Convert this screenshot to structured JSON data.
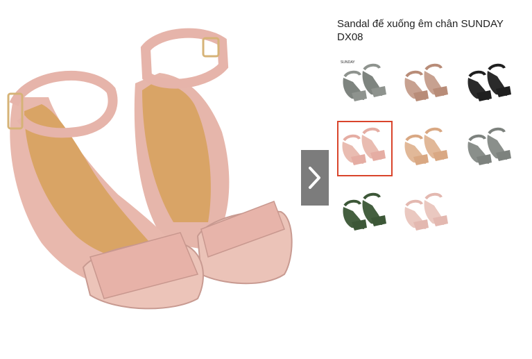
{
  "product": {
    "title": "Sandal đế xuống êm chân SUNDAY DX08",
    "main_color": "#e9bcb1"
  },
  "gallery": {
    "next_icon": "chevron-right-icon",
    "selected_index": 3,
    "accent_color": "#d9442b",
    "thumbnails": [
      {
        "name": "thumb-grey-with-label",
        "upper": "#8e938e",
        "sole": "#7e847f",
        "label": "SUNDAY"
      },
      {
        "name": "thumb-taupe",
        "upper": "#b88c78",
        "sole": "#c7a190",
        "label": ""
      },
      {
        "name": "thumb-black",
        "upper": "#1f1f1f",
        "sole": "#2a2a2a",
        "label": ""
      },
      {
        "name": "thumb-pink",
        "upper": "#e5ada3",
        "sole": "#e9bcb1",
        "label": ""
      },
      {
        "name": "thumb-beige",
        "upper": "#d9a883",
        "sole": "#e1b898",
        "label": ""
      },
      {
        "name": "thumb-grey",
        "upper": "#7d827e",
        "sole": "#8a8f8b",
        "label": ""
      },
      {
        "name": "thumb-green",
        "upper": "#3c5737",
        "sole": "#445f3f",
        "label": ""
      },
      {
        "name": "thumb-light-pink",
        "upper": "#e3b8b0",
        "sole": "#eac8c0",
        "label": ""
      }
    ]
  }
}
